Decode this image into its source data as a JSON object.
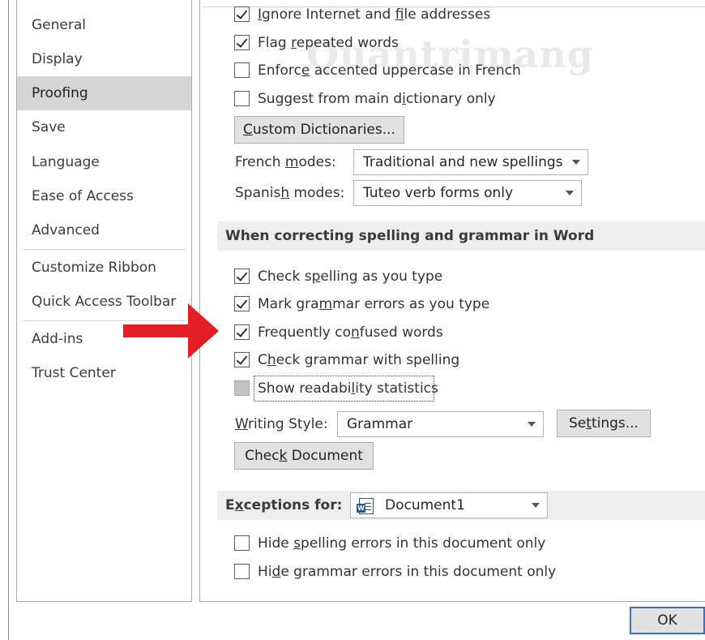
{
  "watermark": "Quantrimang",
  "nav": {
    "items": [
      "General",
      "Display",
      "Proofing",
      "Save",
      "Language",
      "Ease of Access",
      "Advanced",
      "Customize Ribbon",
      "Quick Access Toolbar",
      "Add-ins",
      "Trust Center"
    ],
    "selected": "Proofing"
  },
  "top_options": [
    {
      "pre": "",
      "u": "I",
      "post": "gnore Internet and ",
      "u2": "f",
      "post2": "ile addresses",
      "checked": true
    },
    {
      "pre": "Flag ",
      "u": "r",
      "post": "epeated words",
      "checked": true
    },
    {
      "pre": "Enforc",
      "u": "e",
      "post": " accented uppercase in French",
      "checked": false
    },
    {
      "pre": "Suggest from main d",
      "u": "i",
      "post": "ctionary only",
      "checked": false
    }
  ],
  "custom_dict": {
    "u": "C",
    "post": "ustom Dictionaries..."
  },
  "french_modes": {
    "pre": "French ",
    "u": "m",
    "post": "odes:",
    "value": "Traditional and new spellings"
  },
  "spanish_modes": {
    "pre": "Spanis",
    "u": "h",
    "post": " modes:",
    "value": "Tuteo verb forms only"
  },
  "section_spelling": "When correcting spelling and grammar in Word",
  "word_options": [
    {
      "pre": "Check s",
      "u": "p",
      "post": "elling as you type",
      "checked": true
    },
    {
      "pre": "Mark gra",
      "u": "m",
      "post": "mar errors as you type",
      "checked": true
    },
    {
      "pre": "Frequently co",
      "u": "n",
      "post": "fused words",
      "checked": true
    },
    {
      "pre": "C",
      "u": "h",
      "post": "eck grammar with spelling",
      "checked": true
    },
    {
      "pre": "Show readabi",
      "u": "l",
      "post": "ity statistics",
      "checked": false
    }
  ],
  "writing_style": {
    "pre": "",
    "u": "W",
    "post": "riting Style:",
    "value": "Grammar"
  },
  "settings_button": {
    "pre": "Se",
    "u": "t",
    "post": "tings..."
  },
  "check_document_button": {
    "pre": "Chec",
    "u": "k",
    "post": " Document"
  },
  "exceptions": {
    "pre": "E",
    "u": "x",
    "post": "ceptions for:",
    "value": "Document1",
    "icon": "word-document-icon"
  },
  "exception_options": [
    {
      "pre": "Hide ",
      "u": "s",
      "post": "pelling errors in this document only",
      "checked": false
    },
    {
      "pre": "Hi",
      "u": "d",
      "post": "e grammar errors in this document only",
      "checked": false
    }
  ],
  "ok_button": "OK",
  "colors": {
    "arrow": "#e31e24",
    "selected_nav": "#d5d5d5",
    "section_bg": "#eeeeee",
    "ok_border": "#3b6fb6"
  }
}
